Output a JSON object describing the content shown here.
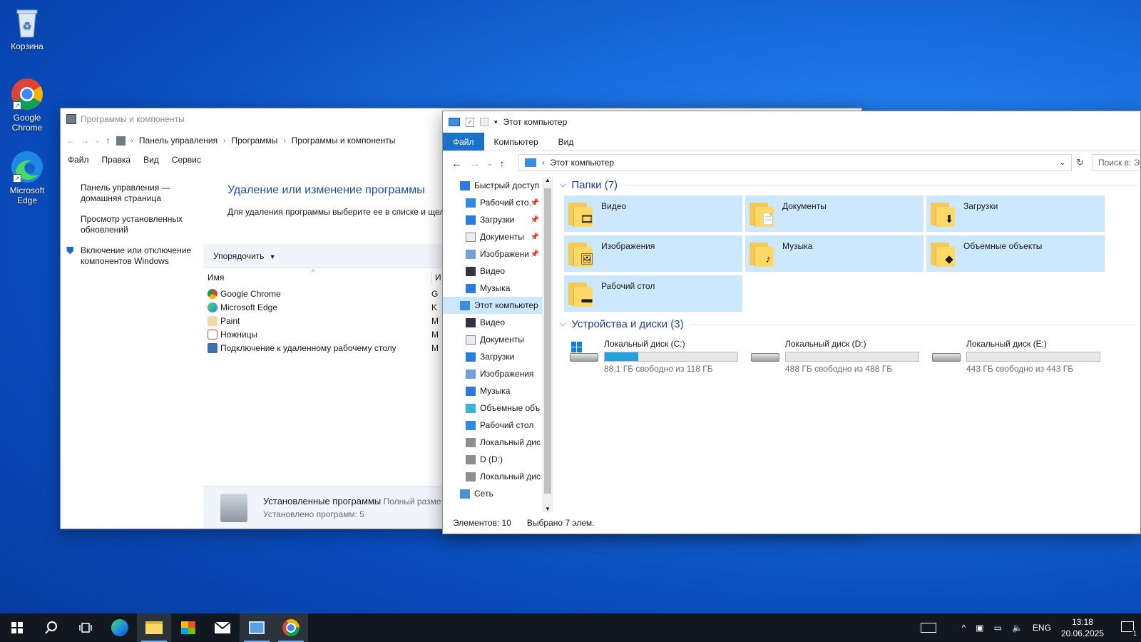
{
  "desktop": {
    "icons": [
      {
        "label": "Корзина"
      },
      {
        "label": "Google Chrome"
      },
      {
        "label": "Microsoft Edge"
      }
    ]
  },
  "control_panel": {
    "title": "Программы и компоненты",
    "breadcrumbs": [
      "Панель управления",
      "Программы",
      "Программы и компоненты"
    ],
    "menu": [
      "Файл",
      "Правка",
      "Вид",
      "Сервис"
    ],
    "left_links": [
      "Панель управления — домашняя страница",
      "Просмотр установленных обновлений",
      "Включение или отключение компонентов Windows"
    ],
    "heading": "Удаление или изменение программы",
    "subtext": "Для удаления программы выберите ее в списке и щел",
    "organize_label": "Упорядочить",
    "column_name": "Имя",
    "column_publisher": "И",
    "programs": [
      {
        "name": "Google Chrome",
        "pub": "G"
      },
      {
        "name": "Microsoft Edge",
        "pub": "K"
      },
      {
        "name": "Paint",
        "pub": "M"
      },
      {
        "name": "Ножницы",
        "pub": "M"
      },
      {
        "name": "Подключение к удаленному рабочему столу",
        "pub": "M"
      }
    ],
    "status_title": "Установленные программы",
    "status_size": "Полный разме",
    "status_count": "Установлено программ: 5"
  },
  "explorer": {
    "title": "Этот компьютер",
    "ribbon_tabs": [
      "Файл",
      "Компьютер",
      "Вид"
    ],
    "address": "Этот компьютер",
    "search_placeholder": "Поиск в: Эт",
    "nav": [
      {
        "label": "Быстрый доступ",
        "top": true,
        "icon": "star-icon"
      },
      {
        "label": "Рабочий сто.",
        "pin": true,
        "icon": "desktop-icon"
      },
      {
        "label": "Загрузки",
        "pin": true,
        "icon": "download-icon"
      },
      {
        "label": "Документы",
        "pin": true,
        "icon": "document-icon"
      },
      {
        "label": "Изображени",
        "pin": true,
        "icon": "image-icon"
      },
      {
        "label": "Видео",
        "icon": "video-icon"
      },
      {
        "label": "Музыка",
        "icon": "music-icon"
      },
      {
        "label": "Этот компьютер",
        "top": true,
        "selected": true,
        "icon": "computer-icon"
      },
      {
        "label": "Видео",
        "icon": "video-icon"
      },
      {
        "label": "Документы",
        "icon": "document-icon"
      },
      {
        "label": "Загрузки",
        "icon": "download-icon"
      },
      {
        "label": "Изображения",
        "icon": "image-icon"
      },
      {
        "label": "Музыка",
        "icon": "music-icon"
      },
      {
        "label": "Объемные объ",
        "icon": "cube-icon"
      },
      {
        "label": "Рабочий стол",
        "icon": "desktop-icon"
      },
      {
        "label": "Локальный дис",
        "icon": "drive-icon"
      },
      {
        "label": "D (D:)",
        "icon": "drive-icon"
      },
      {
        "label": "Локальный дис",
        "icon": "drive-icon"
      },
      {
        "label": "Сеть",
        "top": true,
        "icon": "network-icon"
      }
    ],
    "folders_group": "Папки (7)",
    "folders": [
      {
        "name": "Видео",
        "badge": "🎞"
      },
      {
        "name": "Документы",
        "badge": "📄"
      },
      {
        "name": "Загрузки",
        "badge": "⬇"
      },
      {
        "name": "Изображения",
        "badge": "🖼"
      },
      {
        "name": "Музыка",
        "badge": "♪"
      },
      {
        "name": "Объемные объекты",
        "badge": "◆"
      },
      {
        "name": "Рабочий стол",
        "badge": "▬"
      }
    ],
    "devices_group": "Устройства и диски (3)",
    "drives": [
      {
        "name": "Локальный диск (C:)",
        "free": "88,1 ГБ свободно из 118 ГБ",
        "used_fraction": 0.25,
        "windows": true
      },
      {
        "name": "Локальный диск (D:)",
        "free": "488 ГБ свободно из 488 ГБ",
        "used_fraction": 0.0
      },
      {
        "name": "Локальный диск (E:)",
        "free": "443 ГБ свободно из 443 ГБ",
        "used_fraction": 0.0
      }
    ],
    "status_items": "Элементов: 10",
    "status_selected": "Выбрано 7 элем."
  },
  "taskbar": {
    "lang": "ENG",
    "time": "13:18",
    "date": "20.06.2025",
    "notifications": "1"
  },
  "colors": {
    "accent": "#1a73c8",
    "selection": "#cce8ff",
    "drive_fill": "#26a0da"
  }
}
